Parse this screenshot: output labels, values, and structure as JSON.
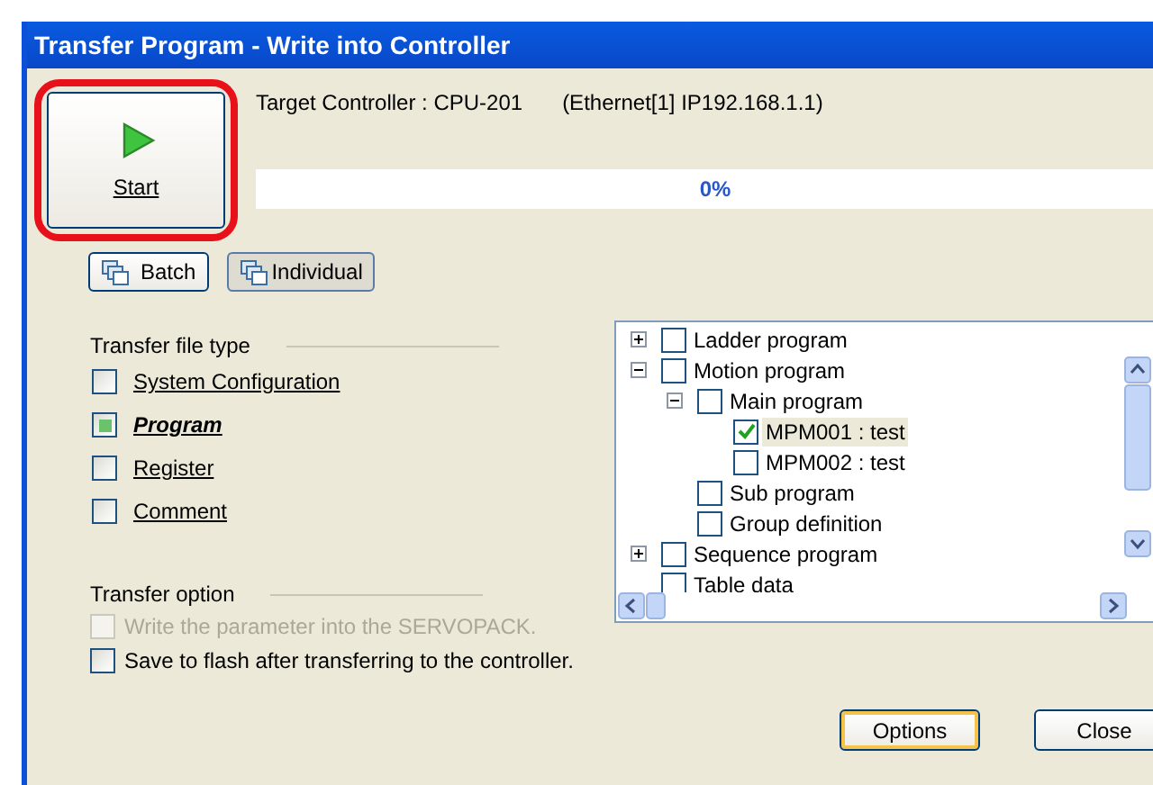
{
  "window": {
    "title": "Transfer Program - Write into Controller"
  },
  "start_button": {
    "label": "Start",
    "highlighted": true
  },
  "target": {
    "controller": "Target Controller : CPU-201",
    "connection": "(Ethernet[1] IP192.168.1.1)"
  },
  "progress": {
    "level": 0,
    "reading": "0%"
  },
  "mode_buttons": [
    {
      "label": "Batch",
      "selected": false
    },
    {
      "label": "Individual",
      "selected": true
    }
  ],
  "transfer_file_type": {
    "heading": "Transfer file type",
    "items": [
      {
        "label": "System Configuration",
        "checked": false
      },
      {
        "label": "Program",
        "checked": true
      },
      {
        "label": "Register",
        "checked": false
      },
      {
        "label": "Comment",
        "checked": false
      }
    ]
  },
  "transfer_option": {
    "heading": "Transfer option",
    "items": [
      {
        "label": "Write the parameter into the SERVOPACK.",
        "checked": false,
        "disabled": true
      },
      {
        "label": "Save to flash after transferring to the controller.",
        "checked": false,
        "disabled": false
      }
    ]
  },
  "tree": [
    {
      "label": "Ladder program",
      "checked": false,
      "selected": false,
      "expanded": false
    },
    {
      "label": "Motion program",
      "checked": false,
      "selected": false,
      "expanded": true,
      "children": [
        {
          "label": "Main program",
          "checked": false,
          "selected": false,
          "expanded": true,
          "children": [
            {
              "label": "MPM001 : test",
              "checked": true,
              "selected": true
            },
            {
              "label": "MPM002 : test",
              "checked": false,
              "selected": false
            }
          ]
        },
        {
          "label": "Sub program",
          "checked": false,
          "selected": false
        },
        {
          "label": "Group definition",
          "checked": false,
          "selected": false
        }
      ]
    },
    {
      "label": "Sequence program",
      "checked": false,
      "selected": false,
      "expanded": false
    },
    {
      "label": "Table data",
      "checked": false,
      "selected": false
    }
  ],
  "buttons": [
    {
      "label": "Options",
      "kind": "default"
    },
    {
      "label": "Close",
      "kind": "normal"
    }
  ]
}
